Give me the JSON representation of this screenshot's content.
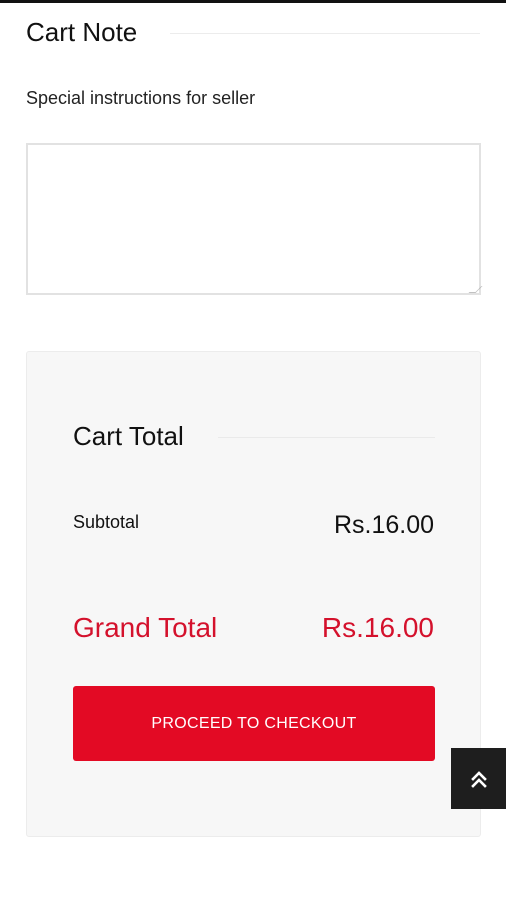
{
  "cart_note": {
    "title": "Cart Note",
    "label": "Special instructions for seller",
    "value": "",
    "placeholder": ""
  },
  "cart_total": {
    "title": "Cart Total",
    "subtotal_label": "Subtotal",
    "subtotal_value": "Rs.16.00",
    "grand_total_label": "Grand Total",
    "grand_total_value": "Rs.16.00",
    "checkout_label": "PROCEED TO CHECKOUT"
  },
  "icons": {
    "back_to_top": "double-chevron-up-icon"
  },
  "colors": {
    "accent": "#e30a24",
    "grand_total_text": "#d4112c",
    "card_background": "#f7f7f7",
    "back_to_top_bg": "#1e1e1e"
  }
}
